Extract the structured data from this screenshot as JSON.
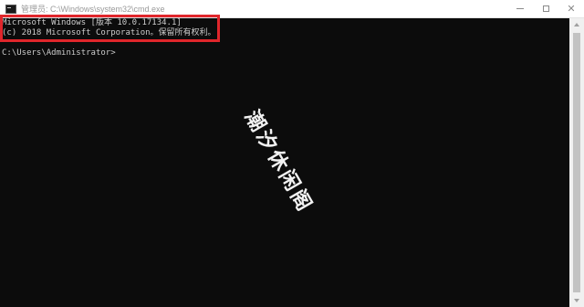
{
  "window": {
    "title": "管理员: C:\\Windows\\system32\\cmd.exe",
    "icon": "cmd-icon",
    "controls": {
      "minimize": "minimize-icon",
      "maximize": "maximize-icon",
      "close": "✕"
    }
  },
  "console": {
    "line1": "Microsoft Windows [版本 10.0.17134.1]",
    "line2": "(c) 2018 Microsoft Corporation。保留所有权利。",
    "prompt": "C:\\Users\\Administrator>"
  },
  "highlight_color": "#e0262b",
  "watermark": "潮汐休闲阁"
}
